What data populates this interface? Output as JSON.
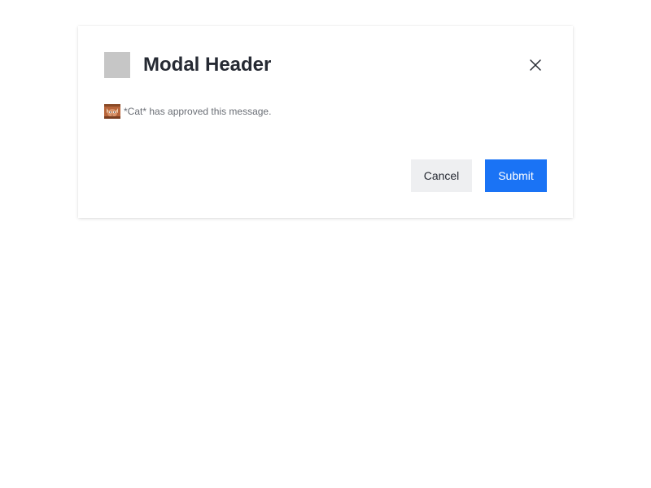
{
  "modal": {
    "title": "Modal Header",
    "header_icon": "placeholder-square-icon",
    "close_icon": "close-icon",
    "message": {
      "avatar_icon": "cat-avatar-icon",
      "text": "*Cat* has approved this message."
    },
    "actions": {
      "cancel_label": "Cancel",
      "submit_label": "Submit"
    }
  },
  "colors": {
    "primary": "#1a73f5",
    "secondary_button_bg": "#eeeff1",
    "title_text": "#262a33",
    "muted_text": "#6b6f76",
    "icon_placeholder": "#c6c6c6"
  }
}
